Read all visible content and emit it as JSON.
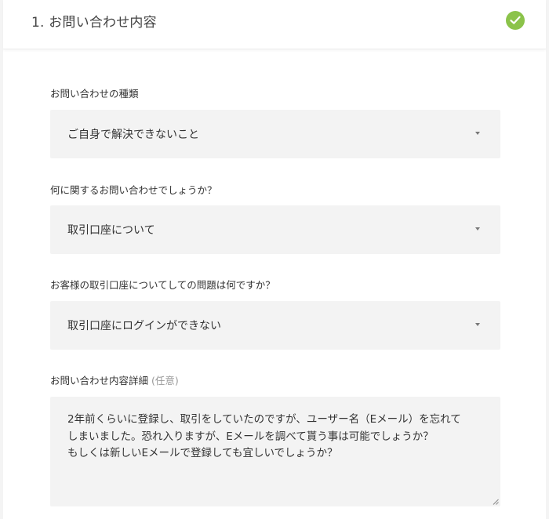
{
  "header": {
    "step_title": "1. お問い合わせ内容"
  },
  "fields": {
    "inquiry_type": {
      "label": "お問い合わせの種類",
      "value": "ご自身で解決できないこと"
    },
    "inquiry_topic": {
      "label": "何に関するお問い合わせでしょうか？",
      "value": "取引口座について"
    },
    "account_problem": {
      "label": "お客様の取引口座についてしての問題は何ですか？",
      "value": "取引口座にログインができない"
    },
    "details": {
      "label": "お問い合わせ内容詳細",
      "optional": "(任意)",
      "value": "2年前くらいに登録し、取引をしていたのですが、ユーザー名（Eメール）を忘れて\nしまいました。恐れ入りますが、Eメールを調べて貰う事は可能でしょうか？\nもしくは新しいEメールで登録しても宜しいでしょうか？"
    }
  },
  "colors": {
    "check_badge": "#8bc34a",
    "field_background": "#f3f3f3",
    "page_background": "#ffffff"
  },
  "icons": {
    "status": "check-circle-icon",
    "dropdown": "caret-down-icon",
    "resize": "resize-handle-icon"
  }
}
